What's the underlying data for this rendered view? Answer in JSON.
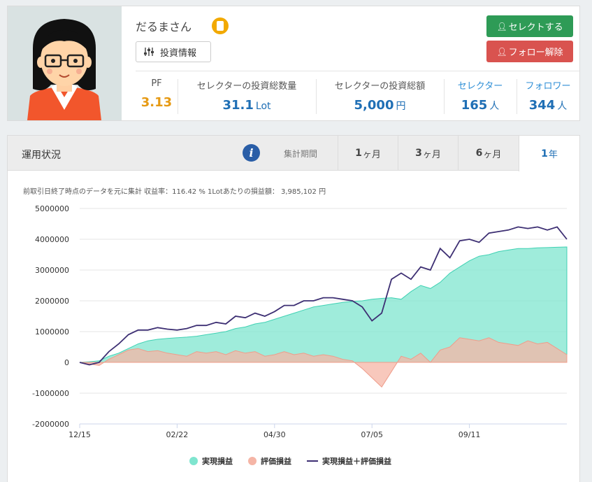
{
  "profile": {
    "name": "だるまさん",
    "info_button_label": "投資情報",
    "select_button_label": "セレクトする",
    "unfollow_button_label": "フォロー解除",
    "stats": [
      {
        "label": "PF",
        "value": "3.13",
        "unit": ""
      },
      {
        "label": "セレクターの投資総数量",
        "value": "31.1",
        "unit": "Lot"
      },
      {
        "label": "セレクターの投資総額",
        "value": "5,000",
        "unit": "円"
      },
      {
        "label": "セレクター",
        "value": "165",
        "unit": "人"
      },
      {
        "label": "フォロワー",
        "value": "344",
        "unit": "人"
      }
    ]
  },
  "performance": {
    "title": "運用状況",
    "period_label": "集計期間",
    "tabs": [
      {
        "num": "1",
        "suffix": "ヶ月",
        "active": false
      },
      {
        "num": "3",
        "suffix": "ヶ月",
        "active": false
      },
      {
        "num": "6",
        "suffix": "ヶ月",
        "active": false
      },
      {
        "num": "1",
        "suffix": "年",
        "active": true
      }
    ],
    "note": "前取引日終了時点のデータを元に集計 収益率：116.42 % 1Lotあたりの損益額： 3,985,102 円"
  },
  "colors": {
    "realized": "#7fe5cf",
    "realized_stroke": "#3fd1b3",
    "unrealized": "#f5b5a6",
    "total": "#3d2f73",
    "accent_blue": "#1f6fb5",
    "pf_orange": "#e69a14",
    "select_green": "#2e9b56",
    "unfollow_red": "#d9534f"
  },
  "chart_data": {
    "type": "area",
    "y_ticks": [
      "5000000",
      "4000000",
      "3000000",
      "2000000",
      "1000000",
      "0",
      "-1000000",
      "-2000000"
    ],
    "ylim": [
      -2000000,
      5000000
    ],
    "x_ticks": [
      "12/15",
      "02/22",
      "04/30",
      "07/05",
      "09/11"
    ],
    "x_tick_positions": [
      0,
      0.2,
      0.4,
      0.6,
      0.8
    ],
    "grid": true,
    "legend_position": "bottom",
    "legend": [
      "実現損益",
      "評価損益",
      "実現損益＋評価損益"
    ],
    "x": [
      0,
      0.02,
      0.04,
      0.06,
      0.08,
      0.1,
      0.12,
      0.14,
      0.16,
      0.18,
      0.2,
      0.22,
      0.24,
      0.26,
      0.28,
      0.3,
      0.32,
      0.34,
      0.36,
      0.38,
      0.4,
      0.42,
      0.44,
      0.46,
      0.48,
      0.5,
      0.52,
      0.54,
      0.56,
      0.58,
      0.6,
      0.62,
      0.64,
      0.66,
      0.68,
      0.7,
      0.72,
      0.74,
      0.76,
      0.78,
      0.8,
      0.82,
      0.84,
      0.86,
      0.88,
      0.9,
      0.92,
      0.94,
      0.96,
      0.98,
      1.0
    ],
    "series": [
      {
        "name": "実現損益",
        "values": [
          0,
          20000,
          50000,
          200000,
          300000,
          450000,
          600000,
          700000,
          750000,
          780000,
          800000,
          820000,
          850000,
          900000,
          950000,
          1000000,
          1100000,
          1150000,
          1250000,
          1300000,
          1400000,
          1500000,
          1600000,
          1700000,
          1800000,
          1850000,
          1900000,
          1950000,
          1980000,
          2000000,
          2050000,
          2080000,
          2100000,
          2050000,
          2300000,
          2500000,
          2400000,
          2600000,
          2900000,
          3100000,
          3300000,
          3450000,
          3500000,
          3600000,
          3650000,
          3700000,
          3700000,
          3720000,
          3730000,
          3740000,
          3750000
        ]
      },
      {
        "name": "評価損益",
        "values": [
          0,
          -50000,
          -100000,
          100000,
          250000,
          400000,
          450000,
          350000,
          380000,
          300000,
          250000,
          200000,
          350000,
          300000,
          350000,
          250000,
          380000,
          300000,
          350000,
          200000,
          250000,
          350000,
          250000,
          300000,
          200000,
          250000,
          200000,
          100000,
          50000,
          -200000,
          -500000,
          -800000,
          -300000,
          200000,
          100000,
          300000,
          0,
          400000,
          500000,
          800000,
          750000,
          700000,
          800000,
          650000,
          600000,
          550000,
          700000,
          600000,
          650000,
          450000,
          250000
        ]
      },
      {
        "name": "実現損益＋評価損益",
        "values": [
          0,
          -80000,
          0,
          350000,
          600000,
          900000,
          1050000,
          1050000,
          1130000,
          1080000,
          1050000,
          1100000,
          1200000,
          1200000,
          1300000,
          1250000,
          1500000,
          1450000,
          1600000,
          1500000,
          1650000,
          1850000,
          1850000,
          2000000,
          2000000,
          2100000,
          2100000,
          2050000,
          2000000,
          1800000,
          1350000,
          1600000,
          2700000,
          2900000,
          2700000,
          3100000,
          3000000,
          3700000,
          3400000,
          3950000,
          4000000,
          3900000,
          4200000,
          4250000,
          4300000,
          4400000,
          4350000,
          4400000,
          4300000,
          4400000,
          4000000
        ]
      }
    ]
  }
}
